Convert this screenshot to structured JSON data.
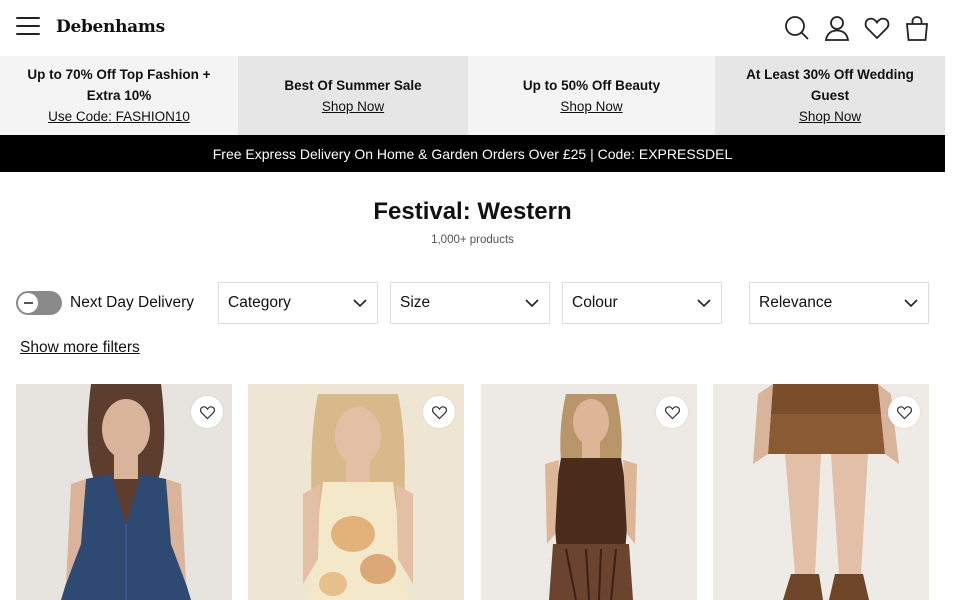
{
  "header": {
    "logo": "Debenhams",
    "icons": [
      "menu-icon",
      "search-icon",
      "account-icon",
      "wishlist-icon",
      "bag-icon"
    ]
  },
  "promos": [
    {
      "line1": "Up to 70% Off Top Fashion +",
      "line2": "Extra 10%",
      "link": "Use Code: FASHION10"
    },
    {
      "line1": "Best Of Summer Sale",
      "link": "Shop Now"
    },
    {
      "line1": "Up to 50% Off Beauty",
      "link": "Shop Now"
    },
    {
      "line1": "At Least 30% Off Wedding",
      "line2": "Guest",
      "link": "Shop Now"
    }
  ],
  "delivery_bar": "Free Express Delivery On Home & Garden Orders Over £25 | Code: EXPRESSDEL",
  "page": {
    "title": "Festival: Western",
    "count": "1,000+ products"
  },
  "filters": {
    "toggle_label": "Next Day Delivery",
    "toggle_on": false,
    "category": "Category",
    "size": "Size",
    "colour": "Colour",
    "sort": "Relevance",
    "more": "Show more filters"
  },
  "products": [
    {
      "name": "denim-halter-dress",
      "wishlist": "heart-icon"
    },
    {
      "name": "floral-print-dress",
      "wishlist": "heart-icon"
    },
    {
      "name": "brown-printed-dress",
      "wishlist": "heart-icon"
    },
    {
      "name": "leather-mini-skirt",
      "wishlist": "heart-icon"
    }
  ],
  "colors": {
    "bar": "#000000",
    "promo_light": "#f4f4f4",
    "promo_dark": "#e6e6e6",
    "toggle": "#8a8a8a"
  }
}
